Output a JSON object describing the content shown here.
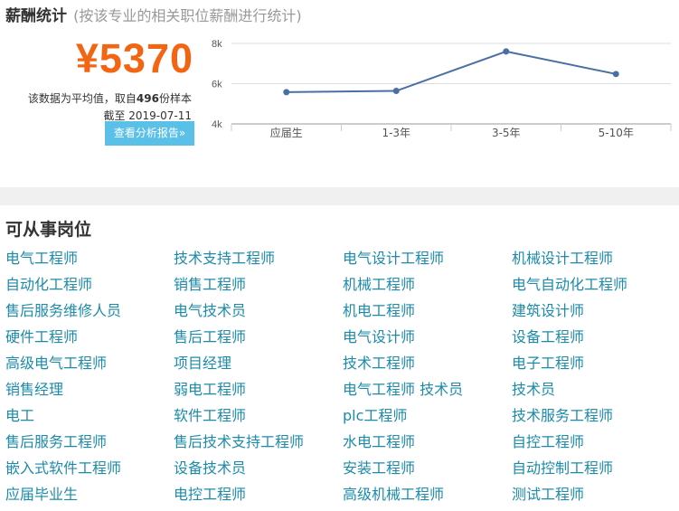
{
  "salary": {
    "title": "薪酬统计",
    "subtitle": "(按该专业的相关职位薪酬进行统计)",
    "value": "¥5370",
    "note_prefix": "该数据为平均值，取自",
    "sample_count": "496",
    "note_suffix": "份样本",
    "date_line": "截至 2019-07-11",
    "report_button": "查看分析报告»"
  },
  "chart_data": {
    "type": "line",
    "categories": [
      "应届生",
      "1-3年",
      "3-5年",
      "5-10年"
    ],
    "values": [
      5580,
      5640,
      7600,
      6480
    ],
    "yticks": [
      "8k",
      "6k",
      "4k"
    ],
    "ylim": [
      4000,
      8000
    ],
    "line_color": "#4a6fa5",
    "grid": true
  },
  "jobs": {
    "title": "可从事岗位",
    "items": [
      "电气工程师",
      "技术支持工程师",
      "电气设计工程师",
      "机械设计工程师",
      "自动化工程师",
      "销售工程师",
      "机械工程师",
      "电气自动化工程师",
      "售后服务维修人员",
      "电气技术员",
      "机电工程师",
      "建筑设计师",
      "硬件工程师",
      "售后工程师",
      "电气设计师",
      "设备工程师",
      "高级电气工程师",
      "项目经理",
      "技术工程师",
      "电子工程师",
      "销售经理",
      "弱电工程师",
      "电气工程师 技术员",
      "技术员",
      "电工",
      "软件工程师",
      "plc工程师",
      "技术服务工程师",
      "售后服务工程师",
      "售后技术支持工程师",
      "水电工程师",
      "自控工程师",
      "嵌入式软件工程师",
      "设备技术员",
      "安装工程师",
      "自动控制工程师",
      "应届毕业生",
      "电控工程师",
      "高级机械工程师",
      "测试工程师"
    ]
  }
}
